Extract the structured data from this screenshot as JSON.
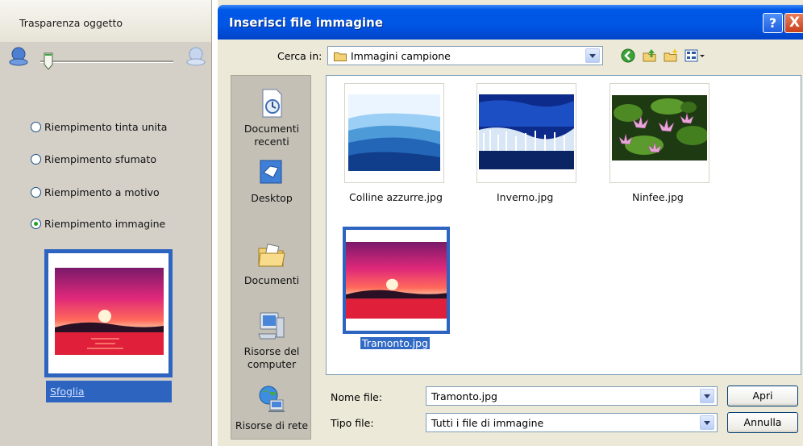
{
  "left_panel": {
    "title": "Trasparenza oggetto",
    "options": [
      {
        "label": "Riempimento tinta unita",
        "selected": false
      },
      {
        "label": "Riempimento sfumato",
        "selected": false
      },
      {
        "label": "Riempimento a motivo",
        "selected": false
      },
      {
        "label": "Riempimento immagine",
        "selected": true
      }
    ],
    "browse_link": "Sfoglia"
  },
  "dialog": {
    "title": "Inserisci file immagine",
    "help_glyph": "?",
    "close_glyph": "X",
    "look_in_label": "Cerca in:",
    "look_in_value": "Immagini campione",
    "places": [
      {
        "label": "Documenti recenti",
        "icon": "recent-documents-icon"
      },
      {
        "label": "Desktop",
        "icon": "desktop-icon"
      },
      {
        "label": "Documenti",
        "icon": "documents-folder-icon"
      },
      {
        "label": "Risorse del computer",
        "icon": "my-computer-icon"
      },
      {
        "label": "Risorse di rete",
        "icon": "network-places-icon"
      }
    ],
    "files": [
      {
        "name": "Colline azzurre.jpg",
        "selected": false
      },
      {
        "name": "Inverno.jpg",
        "selected": false
      },
      {
        "name": "Ninfee.jpg",
        "selected": false
      },
      {
        "name": "Tramonto.jpg",
        "selected": true
      }
    ],
    "file_name_label": "Nome file:",
    "file_name_value": "Tramonto.jpg",
    "file_type_label": "Tipo file:",
    "file_type_value": "Tutti i file di immagine",
    "open_button": "Apri",
    "cancel_button": "Annulla"
  },
  "colors": {
    "selection_blue": "#2d64c0",
    "titlebar_blue": "#0055e5",
    "dialog_bg": "#ece9d8"
  }
}
